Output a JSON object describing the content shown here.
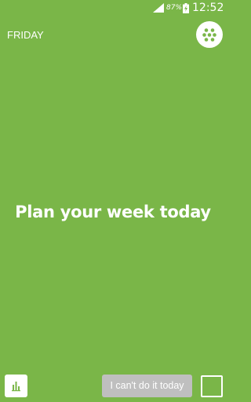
{
  "status_bar": {
    "battery_percent": "87%",
    "time": "12:52",
    "signal_icon": "signal-icon",
    "battery_icon": "battery-charging-icon"
  },
  "header": {
    "day": "FRIDAY",
    "menu_icon": "dots-menu-icon"
  },
  "main": {
    "headline": "Plan your week today"
  },
  "footer": {
    "stats_icon": "bar-chart-icon",
    "cant_do_label": "I can't do it today",
    "checkbox_icon": "empty-checkbox-icon"
  },
  "colors": {
    "background": "#7ab648",
    "accent_green": "#7ab648",
    "disabled_button": "#bfbfbf",
    "text": "#ffffff"
  }
}
